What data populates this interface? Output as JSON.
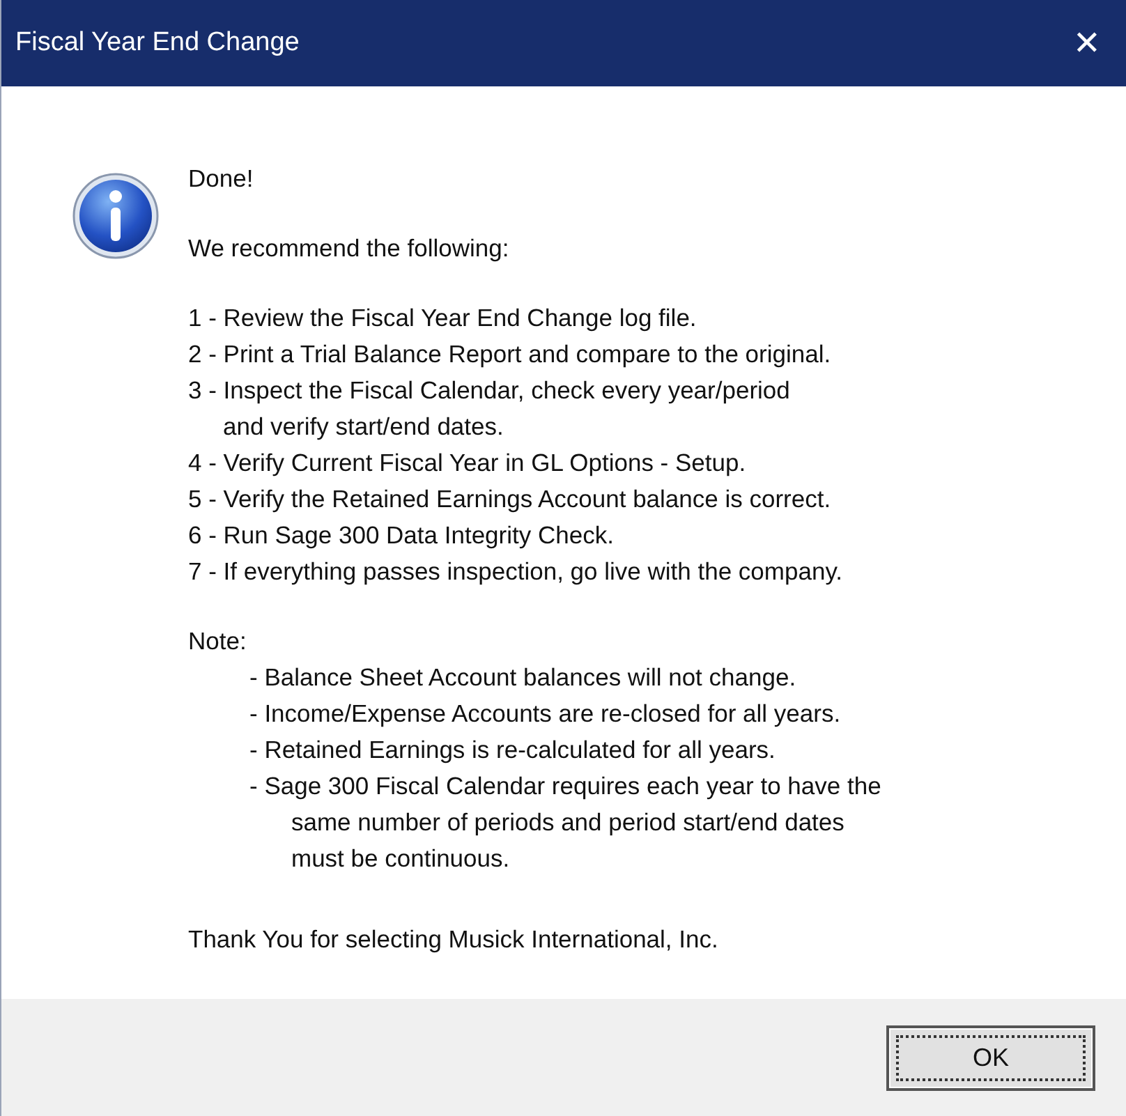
{
  "window": {
    "title": "Fiscal Year End Change",
    "close": "✕"
  },
  "message": {
    "heading": "Done!",
    "intro": "We recommend the following:",
    "steps": [
      {
        "lines": [
          "1 - Review the Fiscal Year End Change log file."
        ]
      },
      {
        "lines": [
          "2 - Print a Trial Balance Report and compare to the original."
        ]
      },
      {
        "lines": [
          "3 - Inspect the Fiscal Calendar, check every year/period",
          "and verify start/end dates."
        ]
      },
      {
        "lines": [
          "4 - Verify Current Fiscal Year in GL Options - Setup."
        ]
      },
      {
        "lines": [
          "5 - Verify the Retained Earnings Account balance is correct."
        ]
      },
      {
        "lines": [
          "6 - Run Sage 300 Data Integrity Check."
        ]
      },
      {
        "lines": [
          "7 - If everything passes inspection, go live with the company."
        ]
      }
    ],
    "note_label": "Note:",
    "notes": [
      {
        "lines": [
          "- Balance Sheet Account balances will not change."
        ]
      },
      {
        "lines": [
          "- Income/Expense Accounts are re-closed for all years."
        ]
      },
      {
        "lines": [
          "- Retained Earnings is re-calculated for all years."
        ]
      },
      {
        "lines": [
          "- Sage 300 Fiscal Calendar requires each year to have the",
          "same number of periods and period start/end dates",
          "must be continuous."
        ]
      }
    ],
    "closing": "Thank You for selecting Musick International, Inc."
  },
  "buttons": [
    {
      "label": "OK",
      "selected": true
    }
  ]
}
